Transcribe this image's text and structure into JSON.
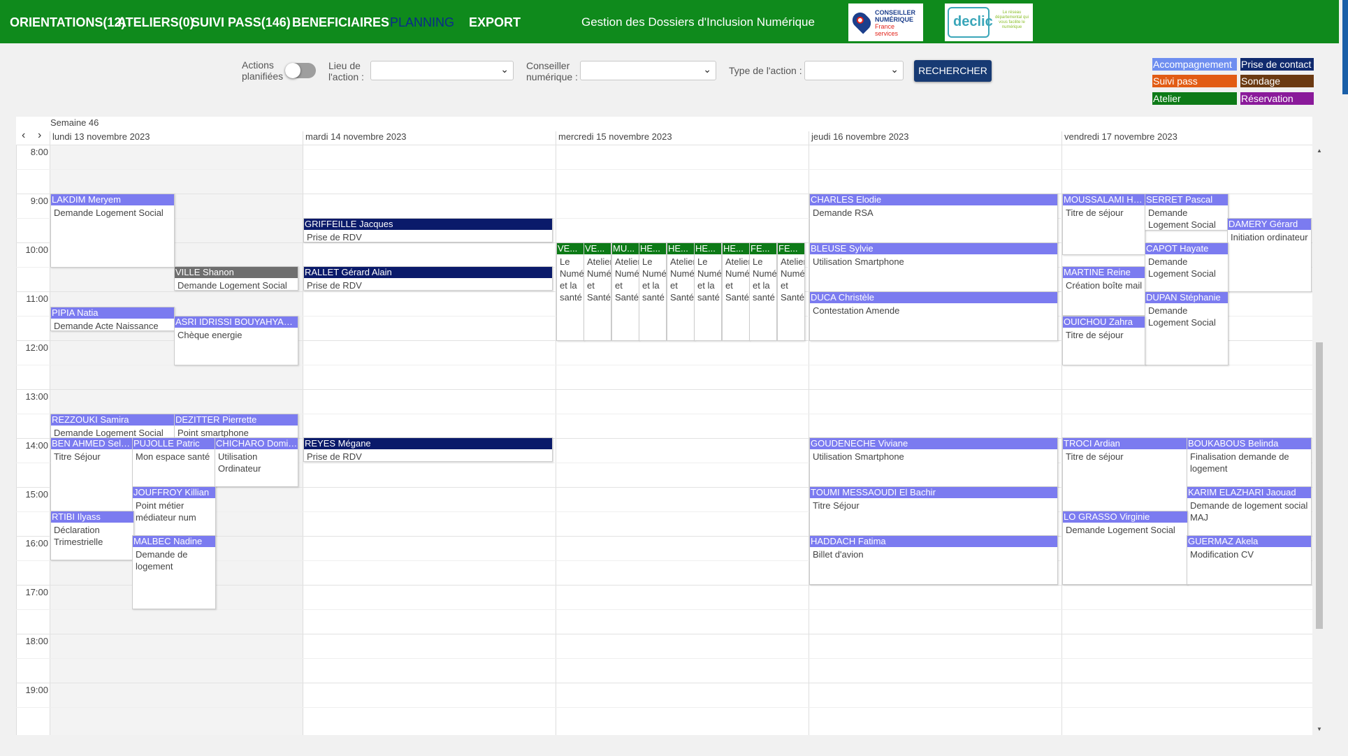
{
  "nav": {
    "items": [
      "ORIENTATIONS(12)",
      "ATELIERS(0)",
      "SUIVI PASS(146)",
      "BENEFICIAIRES",
      "PLANNING",
      "EXPORT"
    ],
    "app_title": "Gestion des Dossiers d'Inclusion Numérique",
    "logo_cn": [
      "CONSEILLER",
      "NUMÉRIQUE",
      "France",
      "services"
    ],
    "logo_declic": "declic",
    "logo_declic_tag": "Le réseau départemental qui vous facilite le numérique"
  },
  "filters": {
    "actions_label_1": "Actions",
    "actions_label_2": "planifiées",
    "lieu_label_1": "Lieu de",
    "lieu_label_2": "l'action :",
    "conseiller_label_1": "Conseiller",
    "conseiller_label_2": "numérique :",
    "type_label": "Type de l'action :",
    "search_button": "RECHERCHER"
  },
  "legend": [
    {
      "label": "Accompagnement",
      "color": "#6e8ef0"
    },
    {
      "label": "Prise de contact",
      "color": "#102a6e"
    },
    {
      "label": "Suivi pass",
      "color": "#e25c14"
    },
    {
      "label": "Sondage",
      "color": "#6b3a12"
    },
    {
      "label": "Atelier",
      "color": "#0d7a17"
    },
    {
      "label": "Réservation",
      "color": "#8a1a9a"
    }
  ],
  "calendar": {
    "week_label": "Semaine 46",
    "prev": "‹",
    "next": "›",
    "days": [
      "lundi 13 novembre 2023",
      "mardi 14 novembre 2023",
      "mercredi 15 novembre 2023",
      "jeudi 16 novembre 2023",
      "vendredi 17 novembre 2023"
    ],
    "hours": [
      "8:00",
      "9:00",
      "10:00",
      "11:00",
      "12:00",
      "13:00",
      "14:00",
      "15:00",
      "16:00",
      "17:00",
      "18:00",
      "19:00"
    ]
  },
  "events": {
    "e1": {
      "name": "LAKDIM Meryem",
      "desc": "Demande Logement Social"
    },
    "e2": {
      "name": "VILLE Shanon",
      "desc": "Demande Logement Social"
    },
    "e3": {
      "name": "PIPIA Natia",
      "desc": "Demande Acte Naissance"
    },
    "e4": {
      "name": "ASRI IDRISSI BOUYAHYAOUI",
      "desc": "Chèque energie"
    },
    "e5": {
      "name": "REZZOUKI Samira",
      "desc": "Demande Logement Social"
    },
    "e6": {
      "name": "DEZITTER Pierrette",
      "desc": "Point smartphone"
    },
    "e7": {
      "name": "BEN AHMED Selma",
      "desc": "Titre Séjour"
    },
    "e8": {
      "name": "PUJOLLE Patric",
      "desc": "Mon espace santé"
    },
    "e9": {
      "name": "CHICHARO Dominique",
      "desc": "Utilisation Ordinateur"
    },
    "e10": {
      "name": "JOUFFROY Killian",
      "desc": "Point métier médiateur num"
    },
    "e11": {
      "name": "RTIBI Ilyass",
      "desc": "Déclaration Trimestrielle"
    },
    "e12": {
      "name": "MALBEC Nadine",
      "desc": "Demande de logement"
    },
    "e13": {
      "name": "GRIFFEILLE Jacques",
      "desc": "Prise de RDV"
    },
    "e14": {
      "name": "RALLET Gérard Alain",
      "desc": "Prise de RDV"
    },
    "e15": {
      "name": "REYES Mégane",
      "desc": "Prise de RDV"
    },
    "a1": {
      "name": "VE...",
      "desc": "Le Numérique et la santé"
    },
    "a2": {
      "name": "VE...",
      "desc": "Atelier Numérique et Santé"
    },
    "a3": {
      "name": "MU...",
      "desc": "Atelier Numérique et Santé"
    },
    "a4": {
      "name": "HE...",
      "desc": "Le Numérique et la santé"
    },
    "a5": {
      "name": "HE...",
      "desc": "Atelier Numérique et Santé"
    },
    "a6": {
      "name": "HE...",
      "desc": "Le Numérique et la santé"
    },
    "a7": {
      "name": "HE...",
      "desc": "Atelier Numérique et Santé"
    },
    "a8": {
      "name": "FE...",
      "desc": "Le Numérique et la santé"
    },
    "a9": {
      "name": "FE...",
      "desc": "Atelier Numérique et Santé"
    },
    "j1": {
      "name": "CHARLES Elodie",
      "desc": "Demande RSA"
    },
    "j2": {
      "name": "BLEUSE Sylvie",
      "desc": "Utilisation Smartphone"
    },
    "j3": {
      "name": "DUCA Christèle",
      "desc": "Contestation Amende"
    },
    "j4": {
      "name": "GOUDENECHE Viviane",
      "desc": "Utilisation Smartphone"
    },
    "j5": {
      "name": "TOUMI MESSAOUDI El Bachir",
      "desc": "Titre Séjour"
    },
    "j6": {
      "name": "HADDACH Fatima",
      "desc": "Billet d'avion"
    },
    "v1": {
      "name": "MOUSSALAMI Hanane",
      "desc": "Titre de séjour"
    },
    "v2": {
      "name": "SERRET Pascal",
      "desc": "Demande Logement Social"
    },
    "v3": {
      "name": "DAMERY Gérard",
      "desc": "Initiation ordinateur"
    },
    "v4": {
      "name": "CAPOT Hayate",
      "desc": "Demande Logement Social"
    },
    "v5": {
      "name": "MARTINE Reine",
      "desc": "Création boîte mail"
    },
    "v6": {
      "name": "DUPAN Stéphanie",
      "desc": "Demande Logement Social"
    },
    "v7": {
      "name": "OUICHOU Zahra",
      "desc": "Titre de séjour"
    },
    "v8": {
      "name": "TROCI Ardian",
      "desc": "Titre de séjour"
    },
    "v9": {
      "name": "BOUKABOUS Belinda",
      "desc": "Finalisation demande de logement"
    },
    "v10": {
      "name": "KARIM ELAZHARI Jaouad",
      "desc": "Demande de logement social MAJ"
    },
    "v11": {
      "name": "LO GRASSO Virginie",
      "desc": "Demande Logement Social"
    },
    "v12": {
      "name": "GUERMAZ Akela",
      "desc": "Modification CV"
    }
  }
}
